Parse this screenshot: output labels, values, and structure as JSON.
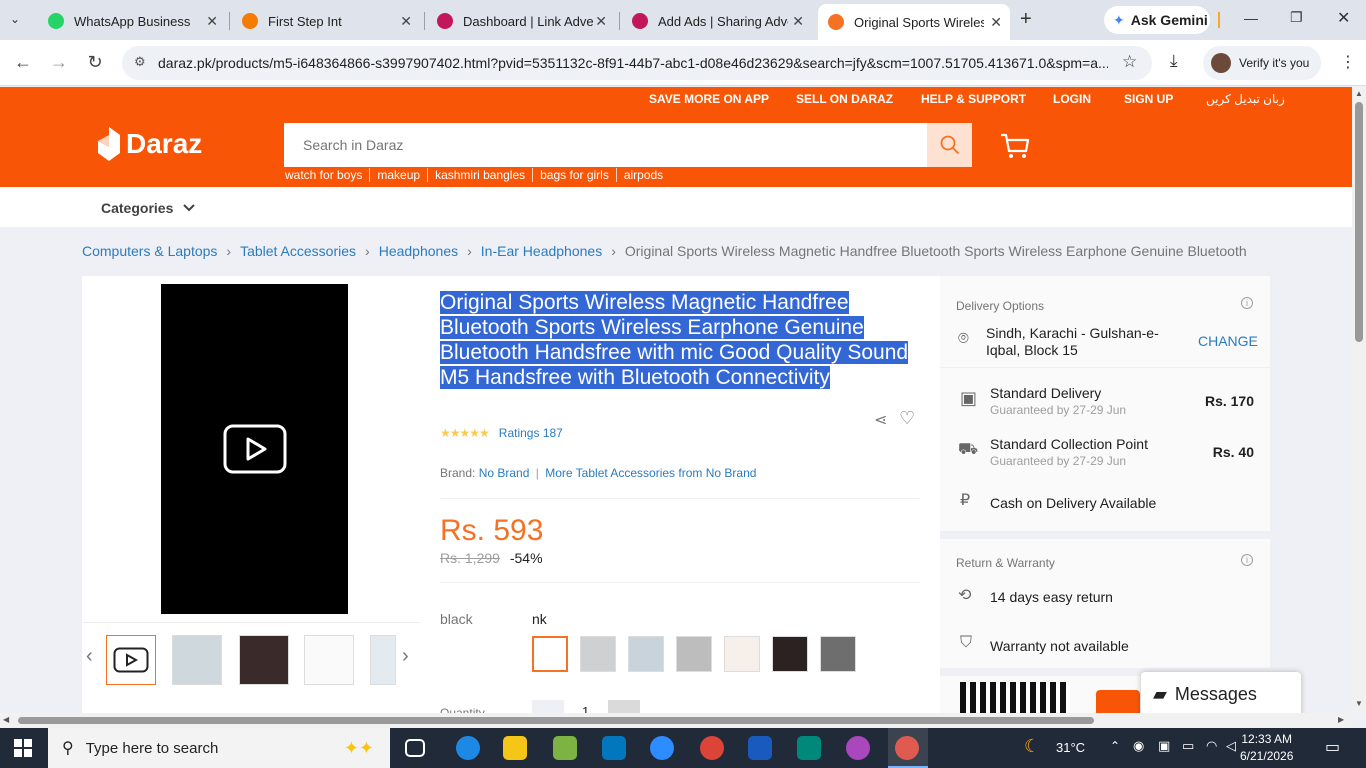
{
  "browser": {
    "tabs": [
      {
        "title": "WhatsApp Business",
        "color": "#25d366"
      },
      {
        "title": "First Step Int",
        "color": "#f57c00"
      },
      {
        "title": "Dashboard | Link Adver",
        "color": "#c2185b"
      },
      {
        "title": "Add Ads | Sharing Adve",
        "color": "#c2185b"
      },
      {
        "title": "Original Sports Wireless",
        "color": "#f57224"
      }
    ],
    "new_tab": "+",
    "gemini_label": "Ask Gemini",
    "url": "daraz.pk/products/m5-i648364866-s3997907402.html?pvid=5351132c-8f91-44b7-abc1-d08e46d23629&search=jfy&scm=1007.51705.413671.0&spm=a...",
    "verify_label": "Verify it's you"
  },
  "daraz": {
    "top_links": [
      "SAVE MORE ON APP",
      "SELL ON DARAZ",
      "HELP & SUPPORT",
      "LOGIN",
      "SIGN UP",
      "زبان تبدیل کریں"
    ],
    "logo_text": "Daraz",
    "search_placeholder": "Search in Daraz",
    "suggestions": [
      "watch for boys",
      "makeup",
      "kashmiri bangles",
      "bags for girls",
      "airpods"
    ],
    "categories_label": "Categories",
    "breadcrumb": [
      "Computers & Laptops",
      "Tablet Accessories",
      "Headphones",
      "In-Ear Headphones"
    ],
    "breadcrumb_current": "Original Sports Wireless Magnetic Handfree Bluetooth Sports Wireless Earphone Genuine Bluetooth"
  },
  "product": {
    "title": "Original Sports Wireless Magnetic Handfree Bluetooth Sports Wireless Earphone Genuine Bluetooth Handsfree with mic Good Quality Sound M5 Handsfree with Bluetooth Connectivity",
    "stars": "★★★★★",
    "rating_fraction": 0.9,
    "ratings_label": "Ratings 187",
    "brand_label": "Brand:",
    "brand_value": "No Brand",
    "more_from": "More Tablet Accessories from No Brand",
    "price": "Rs. 593",
    "old_price": "Rs. 1,299",
    "discount": "-54%",
    "color_label": "black",
    "color_value": "nk",
    "quantity_label": "Quantity",
    "quantity_value": "1"
  },
  "delivery": {
    "options_header": "Delivery Options",
    "location": "Sindh, Karachi - Gulshan-e-Iqbal, Block 15",
    "change_label": "CHANGE",
    "standard_title": "Standard Delivery",
    "standard_sub": "Guaranteed by 27-29 Jun",
    "standard_price": "Rs. 170",
    "collection_title": "Standard Collection Point",
    "collection_sub": "Guaranteed by 27-29 Jun",
    "collection_price": "Rs. 40",
    "cod": "Cash on Delivery Available",
    "return_header": "Return & Warranty",
    "return_days": "14 days easy return",
    "warranty": "Warranty not available",
    "info_icon": "i"
  },
  "messages_label": "Messages",
  "taskbar": {
    "search_placeholder": "Type here to search",
    "temperature": "31°C",
    "time": "12:33 AM",
    "date": "6/21/2026"
  }
}
